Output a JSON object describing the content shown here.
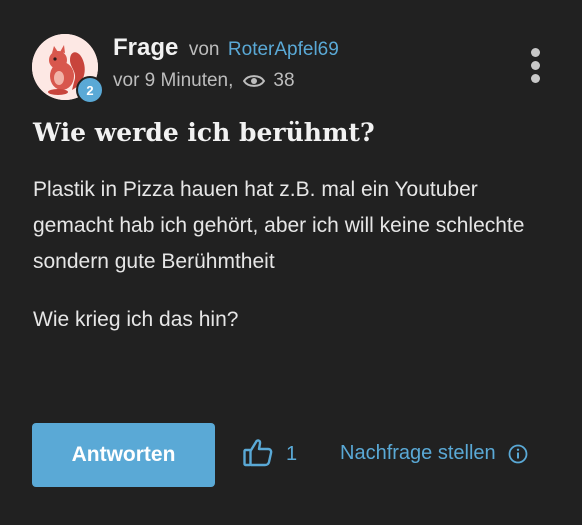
{
  "post": {
    "type_label": "Frage",
    "von": "von",
    "author": "RoterApfel69",
    "avatar_level": "2",
    "time": "vor 9 Minuten,",
    "views": "38"
  },
  "question": {
    "title": "Wie werde ich berühmt?",
    "paragraphs": [
      "Plastik in Pizza hauen hat z.B. mal ein Youtuber gemacht hab ich gehört, aber ich will keine schlechte sondern gute Berühmtheit",
      "Wie krieg ich das hin?"
    ]
  },
  "actions": {
    "answer_label": "Antworten",
    "like_count": "1",
    "followup_label": "Nachfrage stellen"
  },
  "icons": {
    "views": "eye-icon",
    "like": "thumbs-up-icon",
    "info": "info-icon",
    "menu": "more-vertical-icon"
  },
  "colors": {
    "background": "#212121",
    "accent": "#5aa9d6",
    "text": "#ececec",
    "muted": "#bdbdbd"
  }
}
